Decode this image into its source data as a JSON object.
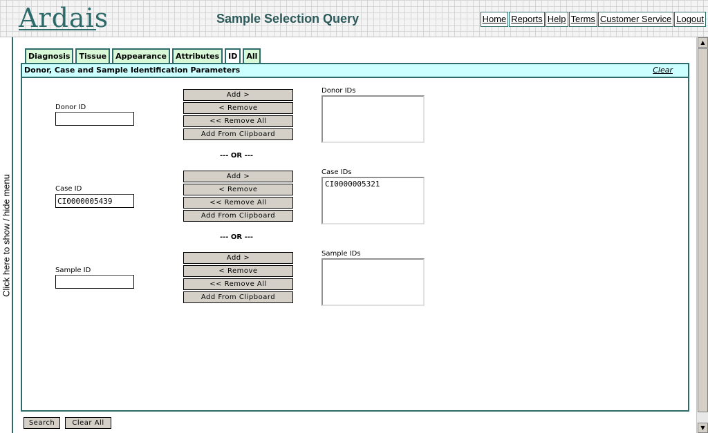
{
  "header": {
    "logo": "Ardais",
    "title": "Sample Selection Query",
    "nav": [
      "Home",
      "Reports",
      "Help",
      "Terms",
      "Customer Service",
      "Logout"
    ]
  },
  "side_menu": {
    "label": "Click here to show / hide menu"
  },
  "tabs": [
    "Diagnosis",
    "Tissue",
    "Appearance",
    "Attributes",
    "ID",
    "All"
  ],
  "active_tab": "ID",
  "panel": {
    "title": "Donor, Case and Sample Identification Parameters",
    "clear_label": "Clear"
  },
  "sections": {
    "donor": {
      "label": "Donor ID",
      "value": "",
      "list_label": "Donor IDs",
      "list_items": []
    },
    "case": {
      "label": "Case ID",
      "value": "CI0000005439",
      "list_label": "Case IDs",
      "list_items": [
        "CI0000005321"
      ]
    },
    "sample": {
      "label": "Sample ID",
      "value": "",
      "list_label": "Sample IDs",
      "list_items": []
    }
  },
  "buttons": {
    "add": "Add >",
    "remove": "< Remove",
    "remove_all": "<< Remove All",
    "add_clipboard": "Add From Clipboard"
  },
  "or_text": "--- OR ---",
  "footer": {
    "search": "Search",
    "clear_all": "Clear All"
  }
}
